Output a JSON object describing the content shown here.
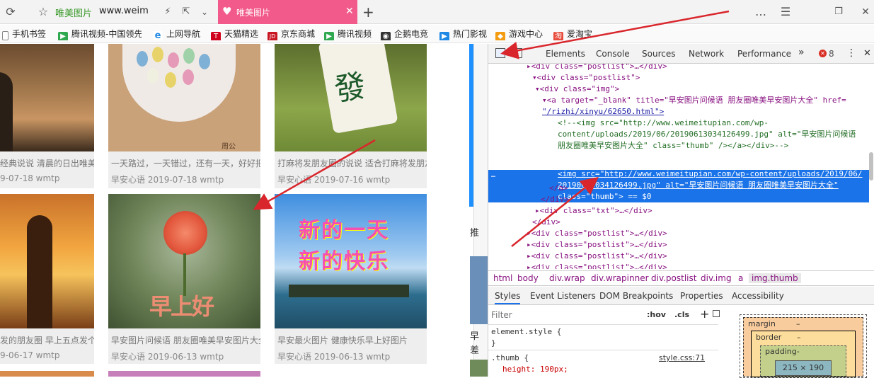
{
  "browser": {
    "site_name": "唯美图片",
    "address": "www.weim",
    "active_tab_title": "唯美图片",
    "new_tab": "+",
    "window_controls": [
      "…",
      "☰",
      "❐",
      "✕"
    ]
  },
  "bookmarks": [
    {
      "label": "手机书签",
      "icon": "bookmark-icon",
      "color": "#666666"
    },
    {
      "label": "腾讯视频-中国领先",
      "icon": "play-icon",
      "color": "#2fa84f"
    },
    {
      "label": "上网导航",
      "icon": "e-icon",
      "color": "#1e88e5"
    },
    {
      "label": "天猫精选",
      "icon": "tmall-icon",
      "color": "#d0021b"
    },
    {
      "label": "京东商城",
      "icon": "jd-icon",
      "color": "#c91623"
    },
    {
      "label": "腾讯视频",
      "icon": "play-icon",
      "color": "#2fa84f"
    },
    {
      "label": "企鹅电竞",
      "icon": "penguin-icon",
      "color": "#333333"
    },
    {
      "label": "热门影视",
      "icon": "video-icon",
      "color": "#1e88e5"
    },
    {
      "label": "游戏中心",
      "icon": "gamepad-icon",
      "color": "#f39c12"
    },
    {
      "label": "爱淘宝",
      "icon": "taobao-icon",
      "color": "#e74c3c"
    }
  ],
  "cards": [
    {
      "caption": "经典说说 清晨的日出唯美银",
      "meta": "9-07-18 wmtp"
    },
    {
      "caption": "一天路过，一天错过，还有一天，好好把",
      "meta": "早安心语 2019-07-18 wmtp"
    },
    {
      "caption": "打麻将发朋友圈的说说 适合打麻将发朋友",
      "meta": "早安心语 2019-07-16 wmtp"
    },
    {
      "caption": "发的朋友圈 早上五点发个朋",
      "meta": "9-06-17 wmtp"
    },
    {
      "caption": "早安图片问候语 朋友圈唯美早安图片大全",
      "meta": "早安心语 2019-06-13 wmtp"
    },
    {
      "caption": "早安最火图片 健康快乐早上好图片",
      "meta": "早安心语 2019-06-13 wmtp"
    }
  ],
  "image_text": {
    "mahjong": "發",
    "watermark": "周公",
    "rose": "早上好",
    "new_day_1": "新的一天",
    "new_day_2": "新的快乐"
  },
  "side_text": {
    "a": "推",
    "b": "早",
    "c": "差"
  },
  "devtools": {
    "tabs": [
      "Elements",
      "Console",
      "Sources",
      "Network",
      "Performance"
    ],
    "more": "»",
    "error_count": "8",
    "dom_lines": [
      "▸<div class=\"postlist\">…</div>",
      "▾<div class=\"postlist\">",
      "▾<div class=\"img\">",
      "▾<a target=\"_blank\" title=\"早安图片问候语 朋友圈唯美早安图片大全\" href=",
      "\"/rizhi/xinyu/62650.html\">",
      "<!--<img src=\"http://www.weimeitupian.com/wp-",
      "content/uploads/2019/06/20190613034126499.jpg\" alt=\"早安图片问候语",
      "朋友圈唯美早安图片大全\" class=\"thumb\" /></a></div>-->",
      "<img src=\"http://www.weimeitupian.com/wp-content/uploads/2019/06/",
      "20190613034126499.jpg\" alt=\"早安图片问候语 朋友圈唯美早安图片大全\"",
      "class=\"thumb\"> == $0",
      "</a>",
      "</div>",
      "▸<div class=\"txt\">…</div>",
      "</div>",
      "▸<div class=\"postlist\">…</div>",
      "▸<div class=\"postlist\">…</div>",
      "▸<div class=\"postlist\">…</div>",
      "▸<div class=\"postlist\">…</div>"
    ],
    "breadcrumbs": [
      "html",
      "body",
      "div.wrap",
      "div.wrapinner",
      "div.postlist",
      "div.img",
      "a",
      "img.thumb"
    ],
    "sub_tabs": [
      "Styles",
      "Event Listeners",
      "DOM Breakpoints",
      "Properties",
      "Accessibility"
    ],
    "filter_placeholder": "Filter",
    "hov": ":hov",
    "cls": ".cls",
    "style_rules": [
      "element.style {",
      "}",
      ".thumb {",
      "height: 190px;"
    ],
    "style_source": "style.css:71",
    "box_model": {
      "margin": "margin",
      "border": "border",
      "padding": "padding-",
      "content": "215 × 190",
      "dash": "–"
    }
  },
  "colors": {
    "accent_tab": "#f25a8b",
    "selection": "#1a73e8",
    "annotation_arrow": "#d9262c"
  }
}
